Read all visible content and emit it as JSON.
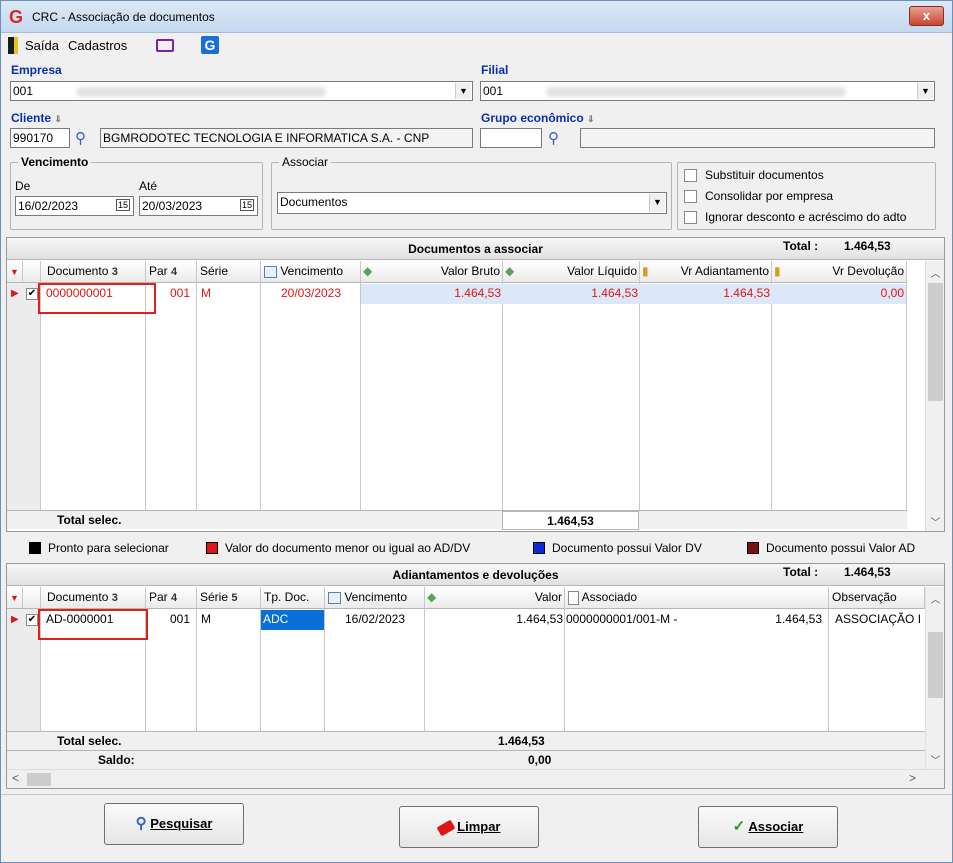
{
  "window": {
    "title": "CRC - Associação de documentos",
    "close": "x"
  },
  "menu": {
    "exit": "Saída",
    "registers": "Cadastros"
  },
  "form": {
    "company_label": "Empresa",
    "company_code": "001",
    "branch_label": "Filial",
    "branch_code": "001",
    "client_label": "Cliente",
    "client_code": "990170",
    "client_name": "BGMRODOTEC TECNOLOGIA E INFORMATICA S.A. - CNP",
    "group_label": "Grupo econômico",
    "due_label": "Vencimento",
    "from_label": "De",
    "from_date": "16/02/2023",
    "to_label": "Até",
    "to_date": "20/03/2023",
    "associate_label": "Associar",
    "associate_value": "Documentos",
    "opt_replace": "Substituir documentos",
    "opt_consolidate": "Consolidar por empresa",
    "opt_ignore": "Ignorar desconto e acréscimo do adto"
  },
  "grid1": {
    "title": "Documentos a associar",
    "total_label": "Total :",
    "total_value": "1.464,53",
    "columns": [
      "Documento",
      "Par",
      "Série",
      "Vencimento",
      "Valor Bruto",
      "Valor Líquido",
      "Vr Adiantamento",
      "Vr Devolução"
    ],
    "sort_doc": "3",
    "sort_par": "4",
    "row": {
      "documento": "0000000001",
      "par": "001",
      "serie": "M",
      "vencimento": "20/03/2023",
      "bruto": "1.464,53",
      "liquido": "1.464,53",
      "adiantamento": "1.464,53",
      "devolucao": "0,00"
    },
    "footer_label": "Total selec.",
    "footer_value": "1.464,53"
  },
  "legend": {
    "items": [
      "Pronto para selecionar",
      "Valor do documento menor ou igual ao AD/DV",
      "Documento possui Valor DV",
      "Documento possui Valor AD"
    ],
    "colors": [
      "#000000",
      "#e01515",
      "#0a2ad8",
      "#7a1010"
    ]
  },
  "grid2": {
    "title": "Adiantamentos e devoluções",
    "total_label": "Total :",
    "total_value": "1.464,53",
    "columns": [
      "Documento",
      "Par",
      "Série",
      "Tp. Doc.",
      "Vencimento",
      "Valor",
      "Associado",
      "Observação"
    ],
    "sort_doc": "3",
    "sort_par": "4",
    "sort_serie": "5",
    "row": {
      "documento": "AD-0000001",
      "par": "001",
      "serie": "M",
      "tipo": "ADC",
      "vencimento": "16/02/2023",
      "valor": "1.464,53",
      "associado": "0000000001/001-M  -",
      "assoc_valor": "1.464,53",
      "observacao": "ASSOCIAÇÃO I"
    },
    "footer_label": "Total selec.",
    "footer_value": "1.464,53",
    "saldo_label": "Saldo:",
    "saldo_value": "0,00"
  },
  "buttons": {
    "search": "Pesquisar",
    "clear": "Limpar",
    "associate": "Associar"
  }
}
